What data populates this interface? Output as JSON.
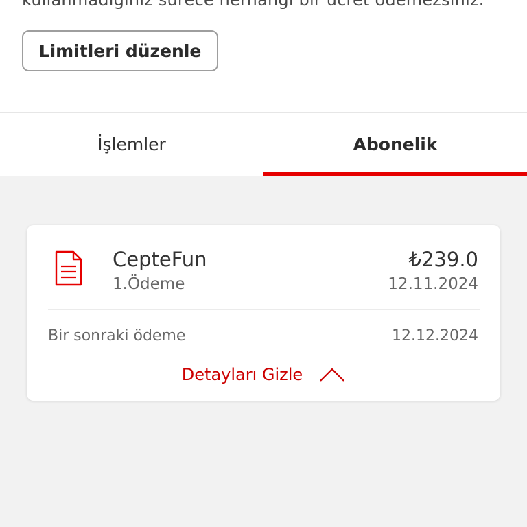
{
  "info_text": "kullanmadığınız sürece herhangi bir ücret ödemezsiniz.",
  "edit_limits_button": "Limitleri düzenle",
  "tabs": [
    {
      "label": "İşlemler",
      "active": false
    },
    {
      "label": "Abonelik",
      "active": true
    }
  ],
  "subscription": {
    "icon": "document-icon",
    "name": "CepteFun",
    "payment_number": "1.Ödeme",
    "amount": "₺239.0",
    "payment_date": "12.11.2024",
    "next_payment_label": "Bir sonraki ödeme",
    "next_payment_date": "12.12.2024",
    "toggle_label": "Detayları Gizle",
    "toggle_icon": "chevron-up-icon"
  },
  "colors": {
    "accent": "#e60000",
    "link": "#cc0000",
    "background": "#f2f2f2"
  }
}
